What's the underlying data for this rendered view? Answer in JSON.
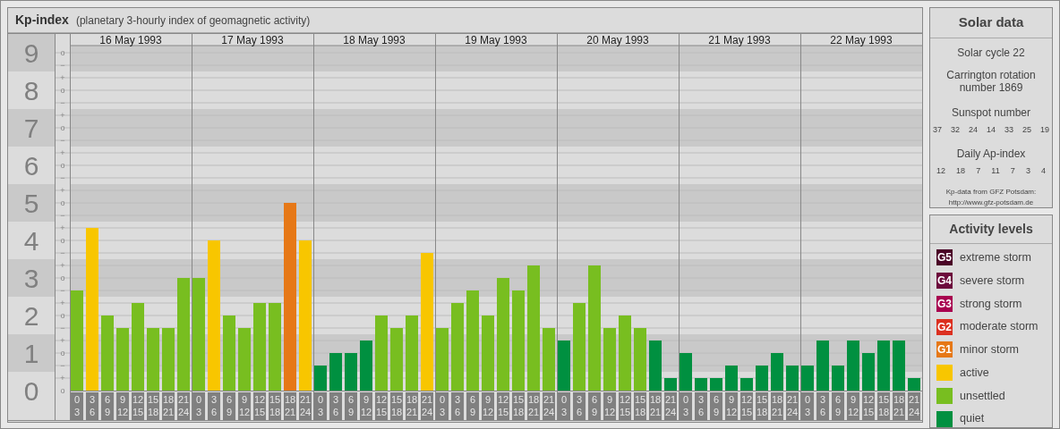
{
  "title": {
    "subtitle": "(planetary 3-hourly index of geomagnetic activity)"
  },
  "y_marks": [
    "o",
    "−",
    "+",
    "o",
    "−",
    "+",
    "o",
    "−",
    "+",
    "o",
    "−",
    "+",
    "o",
    "−",
    "+",
    "o",
    "−",
    "+",
    "o",
    "−",
    "+",
    "o",
    "−",
    "+",
    "o",
    "−",
    "+",
    "o"
  ],
  "days": [
    {
      "date": "16 May 1993",
      "slots": [
        [
          "0",
          "3"
        ],
        [
          "3",
          "6"
        ],
        [
          "6",
          "9"
        ],
        [
          "9",
          "12"
        ],
        [
          "12",
          "15"
        ],
        [
          "15",
          "18"
        ],
        [
          "18",
          "21"
        ],
        [
          "21",
          "24"
        ]
      ]
    },
    {
      "date": "17 May 1993",
      "slots": [
        [
          "0",
          "3"
        ],
        [
          "3",
          "6"
        ],
        [
          "6",
          "9"
        ],
        [
          "9",
          "12"
        ],
        [
          "12",
          "15"
        ],
        [
          "15",
          "18"
        ],
        [
          "18",
          "21"
        ],
        [
          "21",
          "24"
        ]
      ]
    },
    {
      "date": "18 May 1993",
      "slots": [
        [
          "0",
          "3"
        ],
        [
          "3",
          "6"
        ],
        [
          "6",
          "9"
        ],
        [
          "9",
          "12"
        ],
        [
          "12",
          "15"
        ],
        [
          "15",
          "18"
        ],
        [
          "18",
          "21"
        ],
        [
          "21",
          "24"
        ]
      ]
    },
    {
      "date": "19 May 1993",
      "slots": [
        [
          "0",
          "3"
        ],
        [
          "3",
          "6"
        ],
        [
          "6",
          "9"
        ],
        [
          "9",
          "12"
        ],
        [
          "12",
          "15"
        ],
        [
          "15",
          "18"
        ],
        [
          "18",
          "21"
        ],
        [
          "21",
          "24"
        ]
      ]
    },
    {
      "date": "20 May 1993",
      "slots": [
        [
          "0",
          "3"
        ],
        [
          "3",
          "6"
        ],
        [
          "6",
          "9"
        ],
        [
          "9",
          "12"
        ],
        [
          "12",
          "15"
        ],
        [
          "15",
          "18"
        ],
        [
          "18",
          "21"
        ],
        [
          "21",
          "24"
        ]
      ]
    },
    {
      "date": "21 May 1993",
      "slots": [
        [
          "0",
          "3"
        ],
        [
          "3",
          "6"
        ],
        [
          "6",
          "9"
        ],
        [
          "9",
          "12"
        ],
        [
          "12",
          "15"
        ],
        [
          "15",
          "18"
        ],
        [
          "18",
          "21"
        ],
        [
          "21",
          "24"
        ]
      ]
    },
    {
      "date": "22 May 1993",
      "slots": [
        [
          "0",
          "3"
        ],
        [
          "3",
          "6"
        ],
        [
          "6",
          "9"
        ],
        [
          "9",
          "12"
        ],
        [
          "12",
          "15"
        ],
        [
          "15",
          "18"
        ],
        [
          "18",
          "21"
        ],
        [
          "21",
          "24"
        ]
      ]
    }
  ],
  "chart_data": {
    "type": "bar",
    "title": "Kp-index",
    "ylim": [
      0,
      9
    ],
    "yticks": [
      0,
      1,
      2,
      3,
      4,
      5,
      6,
      7,
      8,
      9
    ],
    "grid": true,
    "stacked": true,
    "series": [
      {
        "color": "#009040",
        "values": [
          null,
          null,
          null,
          null,
          null,
          null,
          null,
          null,
          null,
          null,
          null,
          null,
          null,
          null,
          null,
          null,
          0.67,
          1,
          1,
          1.33,
          null,
          null,
          null,
          null,
          null,
          null,
          null,
          null,
          null,
          null,
          null,
          null,
          1.33,
          null,
          null,
          null,
          null,
          null,
          1.33,
          0.33,
          1,
          0.33,
          0.33,
          0.67,
          0.33,
          0.67,
          1,
          0.67,
          0.67,
          1.33,
          0.67,
          1.33,
          1,
          1.33,
          1.33,
          0.33
        ]
      },
      {
        "color": "#78be20",
        "values": [
          2.67,
          null,
          2,
          1.67,
          2.33,
          1.67,
          1.67,
          3,
          3,
          null,
          2,
          1.67,
          2.33,
          2.33,
          null,
          null,
          null,
          null,
          null,
          null,
          2,
          1.67,
          2,
          null,
          1.67,
          2.33,
          2.67,
          2,
          3,
          2.67,
          3.33,
          1.67,
          null,
          2.33,
          3.33,
          1.67,
          2,
          1.67,
          null,
          null,
          null,
          null,
          null,
          null,
          null,
          null,
          null,
          null,
          null,
          null,
          null,
          null,
          null,
          null,
          null,
          null
        ]
      },
      {
        "color": "#f8c600",
        "values": [
          null,
          4.33,
          null,
          null,
          null,
          null,
          null,
          null,
          null,
          4,
          null,
          null,
          null,
          null,
          null,
          4,
          null,
          null,
          null,
          null,
          null,
          null,
          null,
          3.67,
          null,
          null,
          null,
          null,
          null,
          null,
          null,
          null,
          null,
          null,
          null,
          null,
          null,
          null,
          null,
          null,
          null,
          null,
          null,
          null,
          null,
          null,
          null,
          null,
          null,
          null,
          null,
          null,
          null,
          null,
          null,
          null
        ]
      },
      {
        "color": "#e67817",
        "values": [
          null,
          null,
          null,
          null,
          null,
          null,
          null,
          null,
          null,
          null,
          null,
          null,
          null,
          null,
          5,
          null,
          null,
          null,
          null,
          null,
          null,
          null,
          null,
          null,
          null,
          null,
          null,
          null,
          null,
          null,
          null,
          null,
          null,
          null,
          null,
          null,
          null,
          null,
          null,
          null,
          null,
          null,
          null,
          null,
          null,
          null,
          null,
          null,
          null,
          null,
          null,
          null,
          null,
          null,
          null,
          null
        ]
      }
    ]
  },
  "solar_data": {
    "title": "Solar data",
    "solar_cycle": "Solar cycle 22",
    "carrington": "Carrington rotation number 1869",
    "sunspot_title": "Sunspot number",
    "sunspot_numbers": [
      "37",
      "32",
      "24",
      "14",
      "33",
      "25",
      "19"
    ],
    "ap_title": "Daily Ap-index",
    "ap_values": [
      "12",
      "18",
      "7",
      "11",
      "7",
      "3",
      "4"
    ],
    "credit": "Kp-data from GFZ Potsdam:",
    "credit_url": "http://www.gfz-potsdam.de"
  },
  "activity_levels": {
    "title": "Activity levels",
    "items": [
      {
        "badge": "G5",
        "label": "extreme storm",
        "color": "#4a0326"
      },
      {
        "badge": "G4",
        "label": "severe storm",
        "color": "#6c0a3c"
      },
      {
        "badge": "G3",
        "label": "strong storm",
        "color": "#a8004f"
      },
      {
        "badge": "G2",
        "label": "moderate storm",
        "color": "#dc3020"
      },
      {
        "badge": "G1",
        "label": "minor storm",
        "color": "#e67817"
      },
      {
        "label": "active",
        "color": "#f8c600"
      },
      {
        "label": "unsettled",
        "color": "#78be20"
      },
      {
        "label": "quiet",
        "color": "#009040"
      }
    ]
  }
}
